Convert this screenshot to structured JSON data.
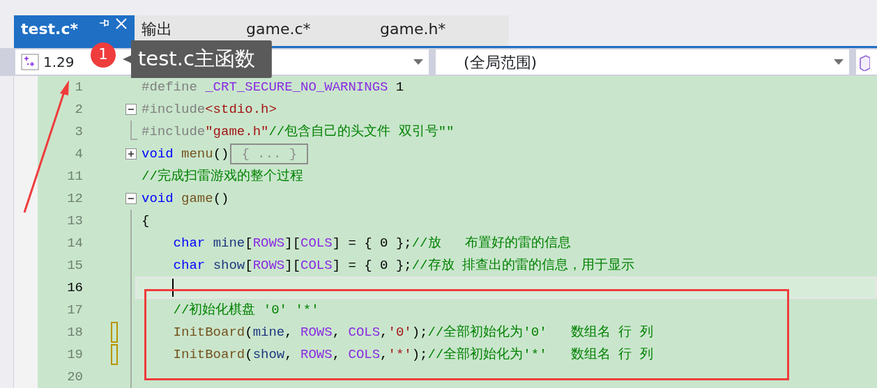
{
  "tabs": [
    {
      "label": "test.c*",
      "selected": true
    },
    {
      "label": "输出",
      "selected": false
    },
    {
      "label": "game.c*",
      "selected": false
    },
    {
      "label": "game.h*",
      "selected": false
    }
  ],
  "navigation": {
    "project_dropdown": "1.29",
    "scope_dropdown": "(全局范围)"
  },
  "annotation": {
    "badge": "1",
    "tooltip": "test.c主函数"
  },
  "lines": [
    {
      "number": "1",
      "tokens": [
        {
          "kind": "pp",
          "text": "#define "
        },
        {
          "kind": "macro",
          "text": "_CRT_SECURE_NO_WARNINGS"
        },
        {
          "kind": "plain",
          "text": " 1"
        }
      ]
    },
    {
      "number": "2",
      "expanded": true,
      "tokens": [
        {
          "kind": "pp",
          "text": "#include"
        },
        {
          "kind": "str",
          "text": "<stdio.h>"
        }
      ],
      "children": [
        {
          "number": "3",
          "tokens": [
            {
              "kind": "pp",
              "text": "#include"
            },
            {
              "kind": "str",
              "text": "\"game.h\""
            },
            {
              "kind": "cm",
              "text": "//包含自己的头文件 双引号\"\""
            }
          ]
        }
      ]
    },
    {
      "number": "4",
      "expanded": false,
      "collapsed": "{ ... }",
      "tokens": [
        {
          "kind": "kw",
          "text": "void "
        },
        {
          "kind": "fn",
          "text": "menu"
        },
        {
          "kind": "plain",
          "text": "()"
        }
      ]
    },
    {
      "number": "11",
      "tokens": [
        {
          "kind": "cm",
          "text": "//完成扫雷游戏的整个过程"
        }
      ]
    },
    {
      "number": "12",
      "expanded": true,
      "tokens": [
        {
          "kind": "kw",
          "text": "void "
        },
        {
          "kind": "fn",
          "text": "game"
        },
        {
          "kind": "plain",
          "text": "()"
        }
      ],
      "children": [
        {
          "number": "13",
          "tokens": [
            {
              "kind": "plain",
              "text": "{"
            }
          ]
        },
        {
          "number": "14",
          "tokens": [
            {
              "kind": "kw",
              "text": "    char "
            },
            {
              "kind": "id",
              "text": "mine"
            },
            {
              "kind": "plain",
              "text": "["
            },
            {
              "kind": "macro",
              "text": "ROWS"
            },
            {
              "kind": "plain",
              "text": "]["
            },
            {
              "kind": "macro",
              "text": "COLS"
            },
            {
              "kind": "plain",
              "text": "] = { 0 };"
            },
            {
              "kind": "cm",
              "text": "//放   布置好的雷的信息"
            }
          ]
        },
        {
          "number": "15",
          "tokens": [
            {
              "kind": "kw",
              "text": "    char "
            },
            {
              "kind": "id",
              "text": "show"
            },
            {
              "kind": "plain",
              "text": "["
            },
            {
              "kind": "macro",
              "text": "ROWS"
            },
            {
              "kind": "plain",
              "text": "]["
            },
            {
              "kind": "macro",
              "text": "COLS"
            },
            {
              "kind": "plain",
              "text": "] = { 0 };"
            },
            {
              "kind": "cm",
              "text": "//存放 排查出的雷的信息，用于显示"
            }
          ]
        },
        {
          "number": "16",
          "current": true
        },
        {
          "number": "17",
          "tokens": [
            {
              "kind": "cm",
              "text": "    //初始化棋盘 '0' '*'"
            }
          ]
        },
        {
          "number": "18",
          "changed": true,
          "tokens": [
            {
              "kind": "fn",
              "text": "    InitBoard"
            },
            {
              "kind": "plain",
              "text": "("
            },
            {
              "kind": "id",
              "text": "mine"
            },
            {
              "kind": "plain",
              "text": ", "
            },
            {
              "kind": "macro",
              "text": "ROWS"
            },
            {
              "kind": "plain",
              "text": ", "
            },
            {
              "kind": "macro",
              "text": "COLS"
            },
            {
              "kind": "plain",
              "text": ","
            },
            {
              "kind": "str",
              "text": "'0'"
            },
            {
              "kind": "plain",
              "text": ");"
            },
            {
              "kind": "cm",
              "text": "//全部初始化为'0'   数组名 行 列"
            }
          ]
        },
        {
          "number": "19",
          "changed": true,
          "tokens": [
            {
              "kind": "fn",
              "text": "    InitBoard"
            },
            {
              "kind": "plain",
              "text": "("
            },
            {
              "kind": "id",
              "text": "show"
            },
            {
              "kind": "plain",
              "text": ", "
            },
            {
              "kind": "macro",
              "text": "ROWS"
            },
            {
              "kind": "plain",
              "text": ", "
            },
            {
              "kind": "macro",
              "text": "COLS"
            },
            {
              "kind": "plain",
              "text": ","
            },
            {
              "kind": "str",
              "text": "'*'"
            },
            {
              "kind": "plain",
              "text": ");"
            },
            {
              "kind": "cm",
              "text": "//全部初始化为'*'   数组名 行 列"
            }
          ]
        },
        {
          "number": "20"
        }
      ]
    }
  ]
}
